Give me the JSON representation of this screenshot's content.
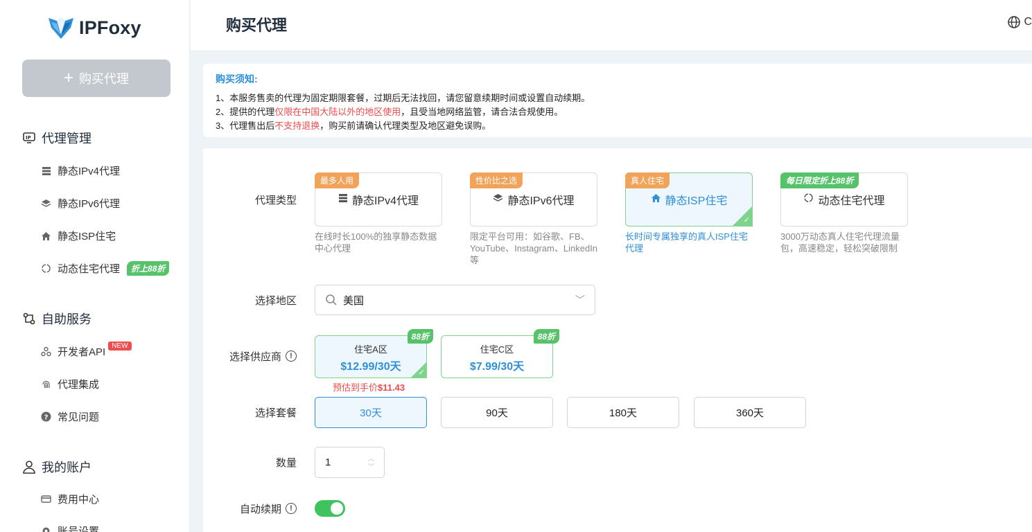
{
  "brand": {
    "name": "IPFoxy"
  },
  "sidebar": {
    "buy_button": "购买代理",
    "groups": [
      {
        "label": "代理管理",
        "items": [
          "静态IPv4代理",
          "静态IPv6代理",
          "静态ISP住宅",
          "动态住宅代理"
        ]
      },
      {
        "label": "自助服务",
        "items": [
          "开发者API",
          "代理集成",
          "常见问题"
        ]
      },
      {
        "label": "我的账户",
        "items": [
          "费用中心",
          "账号设置"
        ]
      }
    ],
    "badge_88": "折上88折",
    "badge_new": "NEW"
  },
  "header": {
    "title": "购买代理",
    "lang_initial": "C"
  },
  "notice": {
    "title": "购买须知:",
    "line1": "1、本服务售卖的代理为固定期限套餐，过期后无法找回，请您留意续期时间或设置自动续期。",
    "line2_a": "2、提供的代理",
    "line2_red": "仅限在中国大陆以外的地区使用",
    "line2_b": "，且受当地网络监管，请合法合规使用。",
    "line3_a": "3、代理售出后",
    "line3_red": "不支持退换",
    "line3_b": "，购买前请确认代理类型及地区避免误购。"
  },
  "form": {
    "labels": {
      "type": "代理类型",
      "region": "选择地区",
      "provider": "选择供应商",
      "plan": "选择套餐",
      "quantity": "数量",
      "auto_renew": "自动续期"
    },
    "types": [
      {
        "tag": "最多人用",
        "name": "静态IPv4代理",
        "desc": "在线时长100%的独享静态数据中心代理"
      },
      {
        "tag": "性价比之选",
        "name": "静态IPv6代理",
        "desc": "限定平台可用：如谷歌、FB、YouTube、Instagram、LinkedIn等"
      },
      {
        "tag": "真人住宅",
        "name": "静态ISP住宅",
        "desc": "长时间专属独享的真人ISP住宅代理"
      },
      {
        "tag": "每日限定折上88折",
        "name": "动态住宅代理",
        "desc": "3000万动态真人住宅代理流量包，高速稳定，轻松突破限制"
      }
    ],
    "region_value": "美国",
    "providers": [
      {
        "name": "住宅A区",
        "price": "$12.99/30天",
        "badge": "88折"
      },
      {
        "name": "住宅C区",
        "price": "$7.99/30天",
        "badge": "88折"
      }
    ],
    "estimate_label": "预估到手价",
    "estimate_value": "$11.43",
    "plans": [
      "30天",
      "90天",
      "180天",
      "360天"
    ],
    "quantity": "1",
    "auto_renew": true
  },
  "colors": {
    "accent": "#2f8fd9",
    "green": "#56c26a",
    "orange": "#f2a35a",
    "red": "#ec4b4b"
  }
}
